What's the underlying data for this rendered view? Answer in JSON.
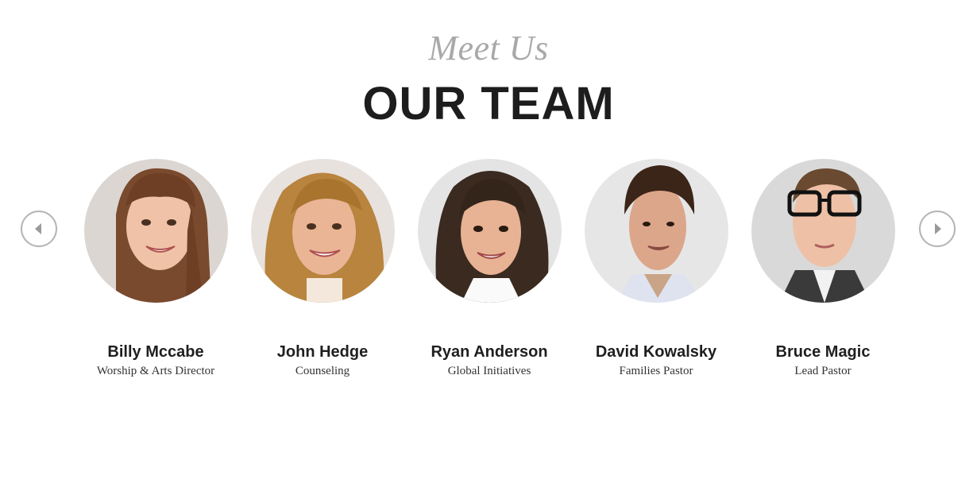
{
  "header": {
    "subtitle": "Meet Us",
    "title": "OUR TEAM"
  },
  "carousel": {
    "prev_icon": "chevron-left-icon",
    "next_icon": "chevron-right-icon"
  },
  "team": [
    {
      "name": "Billy Mccabe",
      "role": "Worship & Arts Director"
    },
    {
      "name": "John Hedge",
      "role": "Counseling"
    },
    {
      "name": "Ryan Anderson",
      "role": "Global Initiatives"
    },
    {
      "name": "David Kowalsky",
      "role": "Families Pastor"
    },
    {
      "name": "Bruce Magic",
      "role": "Lead Pastor"
    }
  ],
  "colors": {
    "subtitle": "#a9a9a9",
    "title": "#1d1d1d",
    "arrow_border": "#b5b5b5"
  }
}
